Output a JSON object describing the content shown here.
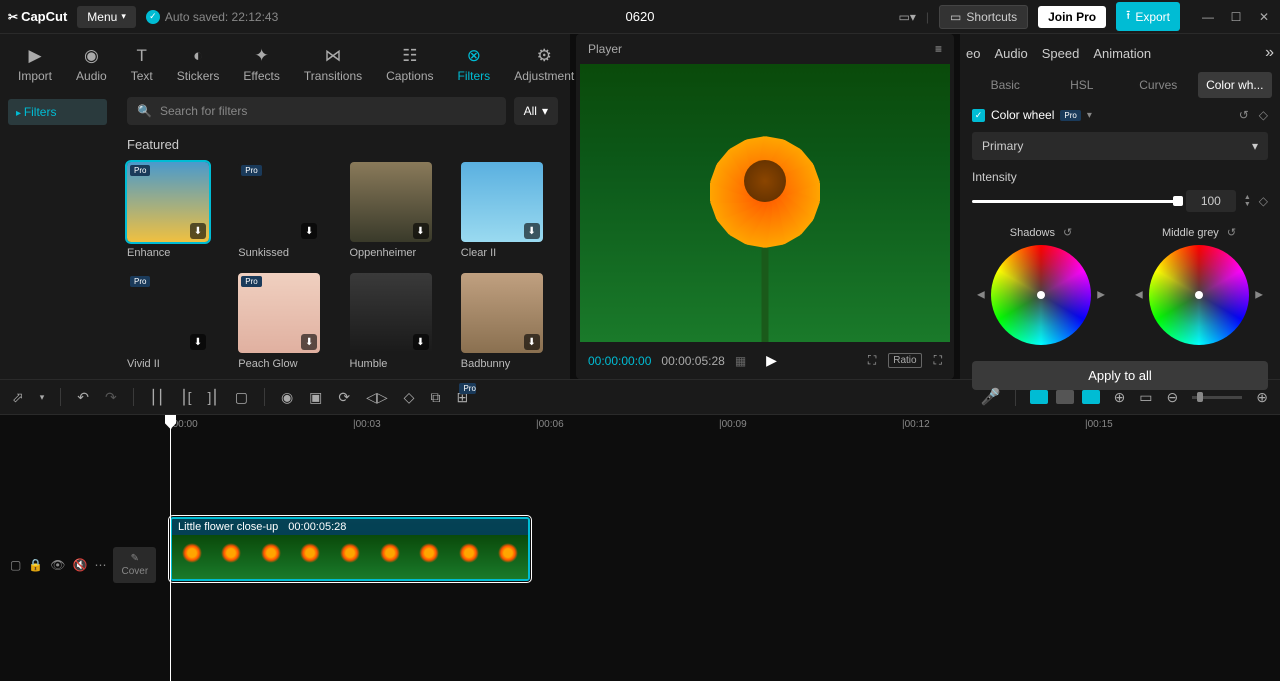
{
  "app": {
    "name": "CapCut",
    "menu": "Menu",
    "autosave": "Auto saved: 22:12:43",
    "project": "0620"
  },
  "titlebar": {
    "shortcuts": "Shortcuts",
    "joinpro": "Join Pro",
    "export": "Export"
  },
  "tabs": {
    "import": "Import",
    "audio": "Audio",
    "text": "Text",
    "stickers": "Stickers",
    "effects": "Effects",
    "transitions": "Transitions",
    "captions": "Captions",
    "filters": "Filters",
    "adjustment": "Adjustment"
  },
  "filters": {
    "folder": "Filters",
    "search_placeholder": "Search for filters",
    "all": "All",
    "section": "Featured",
    "items": [
      {
        "name": "Enhance",
        "pro": true
      },
      {
        "name": "Sunkissed",
        "pro": true
      },
      {
        "name": "Oppenheimer",
        "pro": false
      },
      {
        "name": "Clear II",
        "pro": false
      },
      {
        "name": "Vivid II",
        "pro": true
      },
      {
        "name": "Peach Glow",
        "pro": true
      },
      {
        "name": "Humble",
        "pro": false
      },
      {
        "name": "Badbunny",
        "pro": false
      }
    ]
  },
  "player": {
    "label": "Player",
    "current": "00:00:00:00",
    "total": "00:00:05:28",
    "ratio": "Ratio"
  },
  "right": {
    "tabs": {
      "video": "eo",
      "audio": "Audio",
      "speed": "Speed",
      "animation": "Animation"
    },
    "subtabs": {
      "basic": "Basic",
      "hsl": "HSL",
      "curves": "Curves",
      "colorwheel": "Color wh..."
    },
    "cw_title": "Color wheel",
    "primary": "Primary",
    "intensity_label": "Intensity",
    "intensity_value": "100",
    "shadows": "Shadows",
    "middlegrey": "Middle grey",
    "apply": "Apply to all"
  },
  "timeline": {
    "marks": [
      "00:00",
      "00:03",
      "00:06",
      "00:09",
      "00:12",
      "00:15"
    ],
    "clip_name": "Little flower close-up",
    "clip_duration": "00:00:05:28",
    "cover": "Cover"
  }
}
